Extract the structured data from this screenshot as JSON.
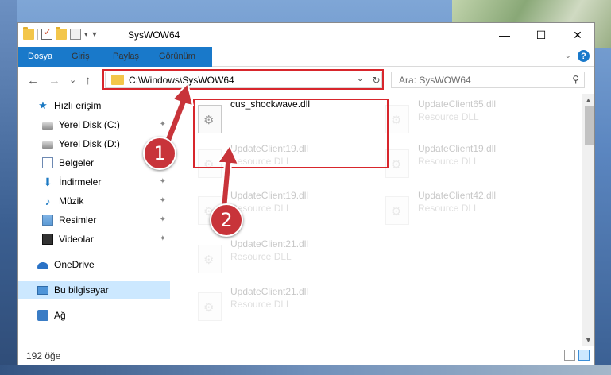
{
  "window": {
    "title": "SysWOW64",
    "qat_dropdown": "▾",
    "qat_pin": "▼",
    "minimize": "—",
    "maximize": "☐",
    "close": "✕"
  },
  "ribbon": {
    "tabs": [
      "Dosya",
      "Giriş",
      "Paylaş",
      "Görünüm"
    ],
    "collapse_chevron": "⌄",
    "help": "?"
  },
  "nav": {
    "back": "←",
    "forward": "→",
    "recent": "⌄",
    "up": "↑"
  },
  "address": {
    "path": "C:\\Windows\\SysWOW64",
    "dropdown": "⌄",
    "refresh": "↻"
  },
  "search": {
    "placeholder": "Ara: SysWOW64",
    "icon": "⚲"
  },
  "sidebar": {
    "items": [
      {
        "label": "Hızlı erişim",
        "icon": "star-icon"
      },
      {
        "label": "Yerel Disk (C:)",
        "icon": "drive-icon",
        "pin": "✦"
      },
      {
        "label": "Yerel Disk (D:)",
        "icon": "drive-icon",
        "pin": "✦"
      },
      {
        "label": "Belgeler",
        "icon": "document-icon",
        "pin": "✦"
      },
      {
        "label": "İndirmeler",
        "icon": "download-icon",
        "pin": "✦"
      },
      {
        "label": "Müzik",
        "icon": "music-icon",
        "pin": "✦"
      },
      {
        "label": "Resimler",
        "icon": "pictures-icon",
        "pin": "✦"
      },
      {
        "label": "Videolar",
        "icon": "video-icon",
        "pin": "✦"
      },
      {
        "label": "OneDrive",
        "icon": "cloud-icon"
      },
      {
        "label": "Bu bilgisayar",
        "icon": "computer-icon"
      },
      {
        "label": "Ağ",
        "icon": "network-icon"
      }
    ]
  },
  "files": [
    {
      "name": "cus_shockwave.dll",
      "type": "",
      "highlighted": true
    },
    {
      "name": "UpdateClient65.dll",
      "type": "Resource DLL"
    },
    {
      "name": "UpdateClient19.dll",
      "type": "Resource DLL"
    },
    {
      "name": "UpdateClient19.dll",
      "type": "Resource DLL"
    },
    {
      "name": "UpdateClient19.dll",
      "type": "Resource DLL"
    },
    {
      "name": "UpdateClient42.dll",
      "type": "Resource DLL"
    },
    {
      "name": "UpdateClient21.dll",
      "type": "Resource DLL"
    },
    {
      "name": "UpdateClient21.dll",
      "type": "Resource DLL"
    }
  ],
  "scrollbar": {
    "up": "▲",
    "down": "▼"
  },
  "status": {
    "count": "192 öğe"
  },
  "callouts": [
    "1",
    "2"
  ],
  "colors": {
    "accent": "#1979ca",
    "annotation": "#d8262c",
    "selection": "#cce8ff"
  }
}
